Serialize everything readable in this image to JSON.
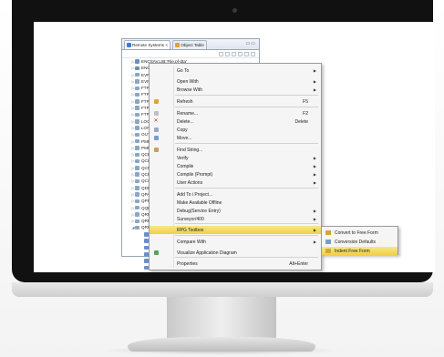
{
  "panel": {
    "tabs": [
      {
        "label": "Remote Systems"
      },
      {
        "label": "Object Table"
      }
    ],
    "tree_rows": [
      {
        "label": "ENCSAV.LIB:'File.pf-dta'"
      },
      {
        "label": "ENCTEST.LIB:'File.dspf"
      },
      {
        "label": "EVFEVENT"
      },
      {
        "label": "EVFTEMPF"
      },
      {
        "label": "FTPOUTPU"
      },
      {
        "label": "FTPOUTPU"
      },
      {
        "label": "FTPSCRIP"
      },
      {
        "label": "FTPSCRIP"
      },
      {
        "label": "FTPSCRIP"
      },
      {
        "label": "LOGFILE.L"
      },
      {
        "label": "LONG.200"
      },
      {
        "label": "OUTFILE.C"
      },
      {
        "label": "PMRESMG"
      },
      {
        "label": "PMRESMG"
      },
      {
        "label": "QCBLLESI"
      },
      {
        "label": "QCLSRC.Y"
      },
      {
        "label": "QCMDSRC"
      },
      {
        "label": "QCPYLESP"
      },
      {
        "label": "QCSRC.*L"
      },
      {
        "label": "QDDSSRC"
      },
      {
        "label": "QPALSRC"
      },
      {
        "label": "QPRCSRC"
      },
      {
        "label": "QQRYOU"
      },
      {
        "label": "QRPGDEI"
      },
      {
        "label": "QRPGLESI"
      },
      {
        "label": "QRPGLESI"
      },
      {
        "label": "ACTD"
      },
      {
        "label": "ACTD"
      },
      {
        "label": "ACTE"
      },
      {
        "label": "ACTE"
      },
      {
        "label": "ADDM"
      },
      {
        "label": "ADDREC.sqlrpgle"
      }
    ]
  },
  "context_menu": {
    "items": [
      {
        "label": "Go To",
        "shortcut": "",
        "submenu": true
      },
      {
        "label": "Open With",
        "shortcut": "",
        "submenu": true
      },
      {
        "label": "Browse With",
        "shortcut": "",
        "submenu": true
      },
      {
        "label": "Refresh",
        "shortcut": "F5",
        "submenu": false
      },
      {
        "label": "Rename...",
        "shortcut": "F2",
        "submenu": false
      },
      {
        "label": "Delete...",
        "shortcut": "Delete",
        "submenu": false
      },
      {
        "label": "Copy",
        "shortcut": "",
        "submenu": false
      },
      {
        "label": "Move...",
        "shortcut": "",
        "submenu": false
      },
      {
        "label": "Find String...",
        "shortcut": "",
        "submenu": false
      },
      {
        "label": "Verify",
        "shortcut": "",
        "submenu": true
      },
      {
        "label": "Compile",
        "shortcut": "",
        "submenu": true
      },
      {
        "label": "Compile (Prompt)",
        "shortcut": "",
        "submenu": true
      },
      {
        "label": "User Actions",
        "shortcut": "",
        "submenu": true
      },
      {
        "label": "Add To i Project...",
        "shortcut": "",
        "submenu": false
      },
      {
        "label": "Make Available Offline",
        "shortcut": "",
        "submenu": false
      },
      {
        "label": "Debug(Service Entry)",
        "shortcut": "",
        "submenu": true
      },
      {
        "label": "Surveyor/400",
        "shortcut": "",
        "submenu": true
      },
      {
        "label": "RPG Toolbox",
        "shortcut": "",
        "submenu": true
      },
      {
        "label": "Compare With",
        "shortcut": "",
        "submenu": true
      },
      {
        "label": "Visualize Application Diagram",
        "shortcut": "",
        "submenu": false
      },
      {
        "label": "Properties",
        "shortcut": "Alt+Enter",
        "submenu": false
      }
    ]
  },
  "submenu": {
    "items": [
      {
        "label": "Convert to Free Form"
      },
      {
        "label": "Conversion Defaults"
      },
      {
        "label": "Indent Free Form"
      }
    ]
  },
  "colors": {
    "highlight": "#f0d046",
    "selection": "#cfe0f7",
    "bezel": "#111111"
  }
}
